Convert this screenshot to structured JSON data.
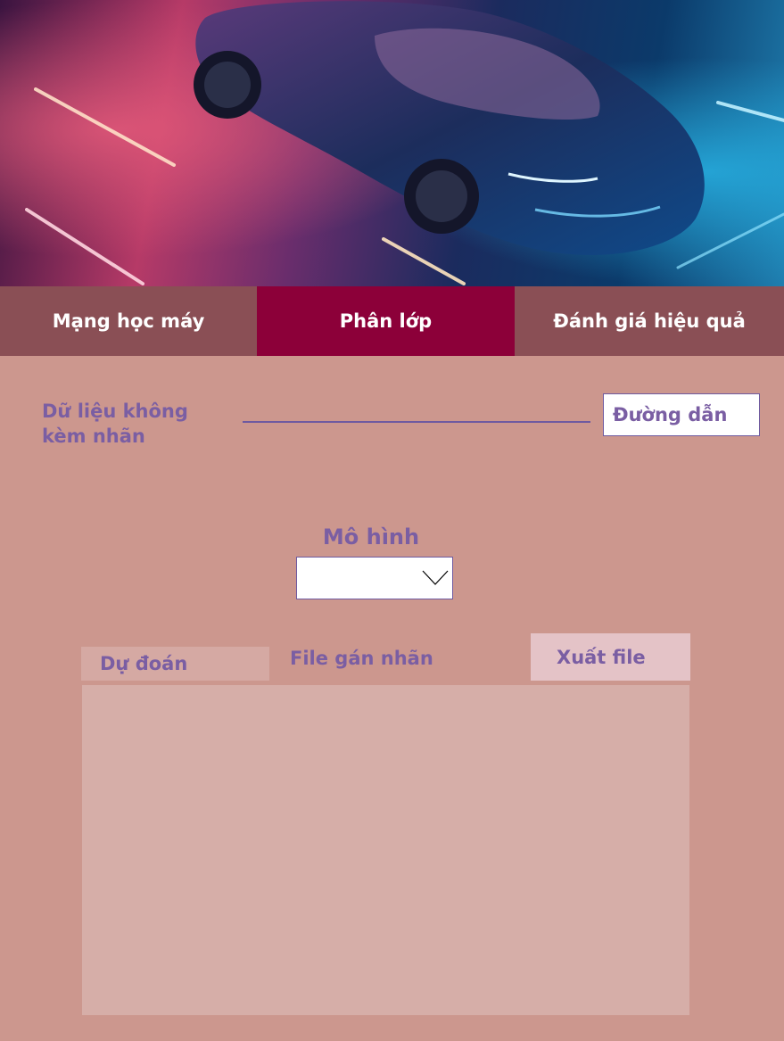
{
  "hero": {
    "image_name": "sports-car-neon-image"
  },
  "tabs": [
    {
      "label": "Mạng học máy",
      "active": false
    },
    {
      "label": "Phân lớp",
      "active": true
    },
    {
      "label": "Đánh giá hiệu quả",
      "active": false
    }
  ],
  "form": {
    "data_label": "Dữ liệu không kèm nhãn",
    "path_button": "Đường dẫn",
    "model_label": "Mô hình",
    "model_value": "",
    "predict_button": "Dự đoán",
    "file_label": "File gán nhãn",
    "export_button": "Xuất file",
    "output_text": ""
  },
  "colors": {
    "background": "#cc978e",
    "tab_inactive": "#8a4f55",
    "tab_active": "#8c0039",
    "label_text": "#7a5ea3"
  }
}
